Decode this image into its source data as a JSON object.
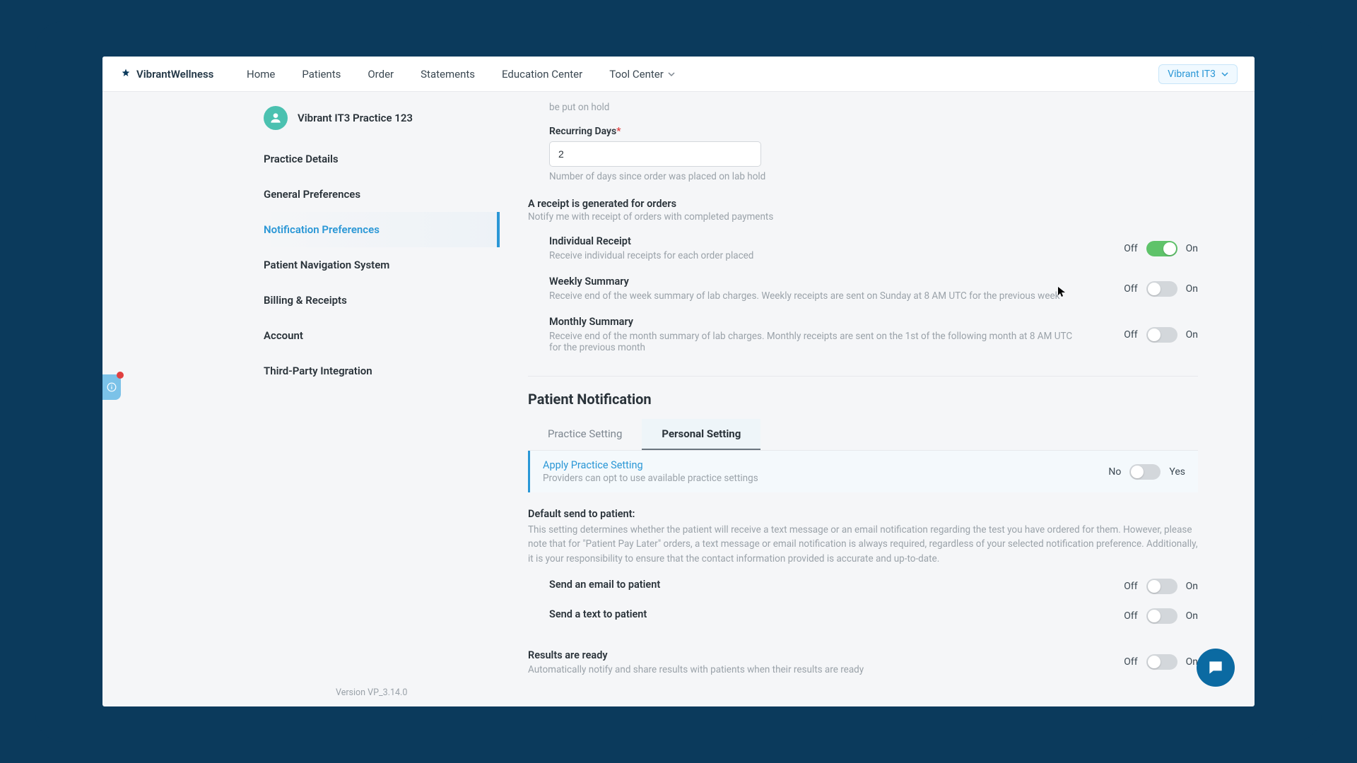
{
  "brand": "VibrantWellness",
  "nav": [
    "Home",
    "Patients",
    "Order",
    "Statements",
    "Education Center",
    "Tool Center"
  ],
  "user_name": "Vibrant IT3",
  "practice_name": "Vibrant IT3 Practice 123",
  "sidebar": [
    "Practice Details",
    "General Preferences",
    "Notification Preferences",
    "Patient Navigation System",
    "Billing & Receipts",
    "Account",
    "Third-Party Integration"
  ],
  "truncated_line": "be put on hold",
  "recurring": {
    "label": "Recurring Days",
    "value": "2",
    "help": "Number of days since order was placed on lab hold"
  },
  "receipt_section": {
    "title": "A receipt is generated for orders",
    "sub": "Notify me with receipt of orders with completed payments",
    "items": [
      {
        "title": "Individual Receipt",
        "sub": "Receive individual receipts for each order placed",
        "on": true
      },
      {
        "title": "Weekly Summary",
        "sub": "Receive end of the week summary of lab charges. Weekly receipts are sent on Sunday at 8 AM UTC for the previous week",
        "on": false
      },
      {
        "title": "Monthly Summary",
        "sub": "Receive end of the month summary of lab charges. Monthly receipts are sent on the 1st of the following month at 8 AM UTC for the previous month",
        "on": false
      }
    ]
  },
  "patient_section": {
    "title": "Patient Notification",
    "tabs": [
      "Practice Setting",
      "Personal Setting"
    ],
    "active_tab": 1,
    "apply": {
      "title": "Apply Practice Setting",
      "sub": "Providers can opt to use available practice settings",
      "off_label": "No",
      "on_label": "Yes",
      "on": false
    },
    "default_title": "Default send to patient:",
    "default_desc": "This setting determines whether the patient will receive a text message or an email notification regarding the test you have ordered for them. However, please note that for \"Patient Pay Later\" orders, a text message or email notification is always required, regardless of your selected notification preference. Additionally, it is your responsibility to ensure that the contact information provided is accurate and up-to-date.",
    "default_items": [
      {
        "title": "Send an email to patient",
        "on": false
      },
      {
        "title": "Send a text to patient",
        "on": false
      }
    ],
    "results": {
      "title": "Results are ready",
      "sub": "Automatically notify and share results with patients when their results are ready",
      "on": false
    }
  },
  "toggle_labels": {
    "off": "Off",
    "on": "On"
  },
  "version": "Version VP_3.14.0"
}
